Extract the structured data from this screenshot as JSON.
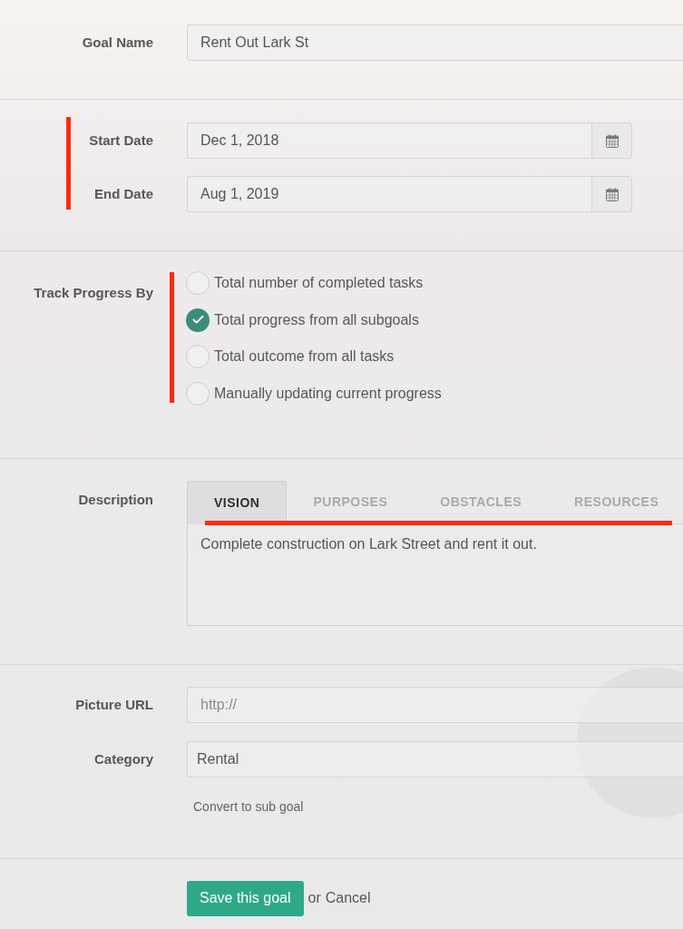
{
  "goal_name": {
    "label": "Goal Name",
    "value": "Rent Out Lark St"
  },
  "dates": {
    "highlighted": true,
    "fields": [
      {
        "label": "Start Date",
        "value": "Dec 1, 2018"
      },
      {
        "label": "End Date",
        "value": "Aug 1, 2019"
      }
    ]
  },
  "track_progress": {
    "label": "Track Progress By",
    "highlighted": true,
    "options": [
      {
        "label": "Total number of completed tasks",
        "selected": false
      },
      {
        "label": "Total progress from all subgoals",
        "selected": true
      },
      {
        "label": "Total outcome from all tasks",
        "selected": false
      },
      {
        "label": "Manually updating current progress",
        "selected": false
      }
    ]
  },
  "description": {
    "label": "Description",
    "tabs_highlighted": true,
    "tabs": [
      {
        "label": "VISION",
        "selected": true
      },
      {
        "label": "PURPOSES",
        "selected": false
      },
      {
        "label": "OBSTACLES",
        "selected": false
      },
      {
        "label": "RESOURCES",
        "selected": false
      }
    ],
    "text": "Complete construction on Lark Street and rent it out."
  },
  "picture_url": {
    "label": "Picture URL",
    "placeholder": "http://"
  },
  "category": {
    "label": "Category",
    "value": "Rental"
  },
  "convert_link": "Convert to sub goal",
  "actions": {
    "save": "Save this goal",
    "or": "or",
    "cancel": "Cancel"
  }
}
